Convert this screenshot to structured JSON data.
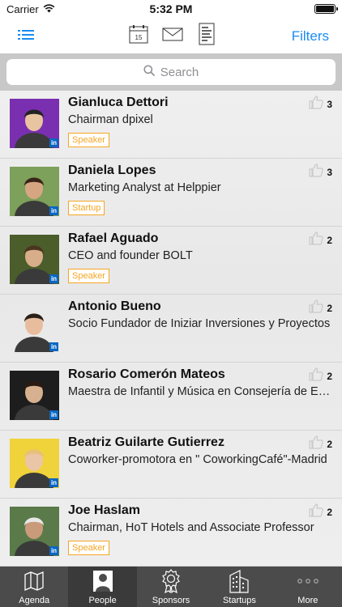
{
  "status_bar": {
    "carrier": "Carrier",
    "time": "5:32 PM"
  },
  "nav": {
    "filters_label": "Filters",
    "calendar_day": "15"
  },
  "search": {
    "placeholder": "Search"
  },
  "people": [
    {
      "name": "Gianluca Dettori",
      "title": "Chairman dpixel",
      "tag": "Speaker",
      "likes": "3"
    },
    {
      "name": "Daniela Lopes",
      "title": "Marketing Analyst at Helppier",
      "tag": "Startup",
      "likes": "3"
    },
    {
      "name": "Rafael Aguado",
      "title": "CEO and founder BOLT",
      "tag": "Speaker",
      "likes": "2"
    },
    {
      "name": "Antonio Bueno",
      "title": "Socio Fundador de Iniziar Inversiones y Proyectos",
      "tag": "",
      "likes": "2"
    },
    {
      "name": "Rosario Comerón Mateos",
      "title": "Maestra de Infantil y Música en Consejería de Educación",
      "tag": "",
      "likes": "2"
    },
    {
      "name": "Beatriz Guilarte Gutierrez",
      "title": "Coworker-promotora en \" CoworkingCafé\"-Madrid",
      "tag": "",
      "likes": "2"
    },
    {
      "name": "Joe Haslam",
      "title": "Chairman, HoT Hotels and Associate Professor",
      "tag": "Speaker",
      "likes": "2"
    }
  ],
  "linkedin_badge": "in",
  "tabs": [
    {
      "label": "Agenda",
      "icon": "map-icon"
    },
    {
      "label": "People",
      "icon": "person-icon"
    },
    {
      "label": "Sponsors",
      "icon": "rosette-icon"
    },
    {
      "label": "Startups",
      "icon": "building-icon"
    },
    {
      "label": "More",
      "icon": "more-dots-icon"
    }
  ],
  "colors": {
    "accent": "#1a8cf0",
    "tag": "#f5a623",
    "tab_bar": "#4b4b4b",
    "linkedin": "#0a66c2"
  }
}
